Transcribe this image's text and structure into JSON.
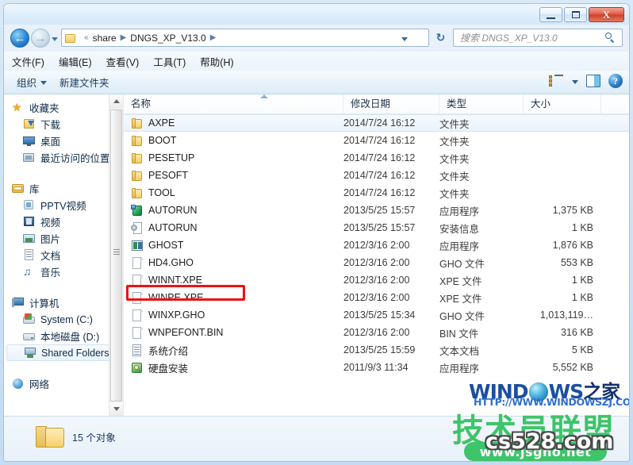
{
  "window": {
    "minimize_label": "Minimize",
    "maximize_label": "Maximize",
    "close_label": "X"
  },
  "address": {
    "back_glyph": "←",
    "forward_glyph": "→",
    "refresh_glyph": "↻",
    "root_sep": "«",
    "crumb1": "share",
    "crumb_sep": "▶",
    "crumb2": "DNGS_XP_V13.0",
    "trailing_sep": "▶"
  },
  "search": {
    "placeholder": "搜索 DNGS_XP_V13.0"
  },
  "menubar": {
    "items": [
      {
        "label": "文件(F)"
      },
      {
        "label": "编辑(E)"
      },
      {
        "label": "查看(V)"
      },
      {
        "label": "工具(T)"
      },
      {
        "label": "帮助(H)"
      }
    ]
  },
  "toolbar": {
    "organize_label": "组织",
    "new_folder_label": "新建文件夹",
    "help_glyph": "?"
  },
  "sidebar": {
    "groups": [
      {
        "header": {
          "label": "收藏夹",
          "icon": "star-icon"
        },
        "items": [
          {
            "label": "下载",
            "icon": "downloads-icon"
          },
          {
            "label": "桌面",
            "icon": "desktop-icon"
          },
          {
            "label": "最近访问的位置",
            "icon": "recent-places-icon"
          }
        ]
      },
      {
        "header": {
          "label": "库",
          "icon": "library-icon"
        },
        "items": [
          {
            "label": "PPTV视频",
            "icon": "pptv-icon"
          },
          {
            "label": "视频",
            "icon": "videos-icon"
          },
          {
            "label": "图片",
            "icon": "pictures-icon"
          },
          {
            "label": "文档",
            "icon": "documents-icon"
          },
          {
            "label": "音乐",
            "icon": "music-icon"
          }
        ]
      },
      {
        "header": {
          "label": "计算机",
          "icon": "computer-icon"
        },
        "items": [
          {
            "label": "System (C:)",
            "icon": "system-drive-icon"
          },
          {
            "label": "本地磁盘 (D:)",
            "icon": "drive-icon"
          },
          {
            "label": "Shared Folders",
            "icon": "shared-folders-icon",
            "selected": true
          }
        ]
      },
      {
        "header": {
          "label": "网络",
          "icon": "network-icon"
        },
        "items": []
      }
    ]
  },
  "filelist": {
    "columns": [
      {
        "label": "名称"
      },
      {
        "label": "修改日期"
      },
      {
        "label": "类型"
      },
      {
        "label": "大小"
      }
    ],
    "rows": [
      {
        "name": "AXPE",
        "date": "2014/7/24 16:12",
        "type": "文件夹",
        "size": "",
        "icon": "folder-icon",
        "selected": true
      },
      {
        "name": "BOOT",
        "date": "2014/7/24 16:12",
        "type": "文件夹",
        "size": "",
        "icon": "folder-icon"
      },
      {
        "name": "PESETUP",
        "date": "2014/7/24 16:12",
        "type": "文件夹",
        "size": "",
        "icon": "folder-icon"
      },
      {
        "name": "PESOFT",
        "date": "2014/7/24 16:12",
        "type": "文件夹",
        "size": "",
        "icon": "folder-icon"
      },
      {
        "name": "TOOL",
        "date": "2014/7/24 16:12",
        "type": "文件夹",
        "size": "",
        "icon": "folder-icon"
      },
      {
        "name": "AUTORUN",
        "date": "2013/5/25 15:57",
        "type": "应用程序",
        "size": "1,375 KB",
        "icon": "application-icon",
        "highlighted": true
      },
      {
        "name": "AUTORUN",
        "date": "2013/5/25 15:57",
        "type": "安装信息",
        "size": "1 KB",
        "icon": "setup-information-icon"
      },
      {
        "name": "GHOST",
        "date": "2012/3/16 2:00",
        "type": "应用程序",
        "size": "1,876 KB",
        "icon": "ghost-app-icon"
      },
      {
        "name": "HD4.GHO",
        "date": "2012/3/16 2:00",
        "type": "GHO 文件",
        "size": "553 KB",
        "icon": "generic-file-icon"
      },
      {
        "name": "WINNT.XPE",
        "date": "2012/3/16 2:00",
        "type": "XPE 文件",
        "size": "1 KB",
        "icon": "generic-file-icon"
      },
      {
        "name": "WINPE.XPE",
        "date": "2012/3/16 2:00",
        "type": "XPE 文件",
        "size": "1 KB",
        "icon": "generic-file-icon"
      },
      {
        "name": "WINXP.GHO",
        "date": "2013/5/25 15:34",
        "type": "GHO 文件",
        "size": "1,013,119…",
        "icon": "generic-file-icon"
      },
      {
        "name": "WNPEFONT.BIN",
        "date": "2012/3/16 2:00",
        "type": "BIN 文件",
        "size": "316 KB",
        "icon": "generic-file-icon"
      },
      {
        "name": "系统介绍",
        "date": "2013/5/25 15:59",
        "type": "文本文档",
        "size": "5 KB",
        "icon": "text-document-icon"
      },
      {
        "name": "硬盘安装",
        "date": "2011/9/3 11:34",
        "type": "应用程序",
        "size": "5,552 KB",
        "icon": "setup-application-icon"
      }
    ]
  },
  "statusbar": {
    "item_count": "15 个对象"
  },
  "watermark": {
    "brand_part1": "WIND",
    "brand_part2": "WS",
    "brand_cn": "之家",
    "url": "HTTP://WWW.WINDOWSZJ.COM/",
    "jsg_cn": "技术员联盟",
    "jsg_url": "www.jsgho.net",
    "cs_url": "cs528.com"
  },
  "colors": {
    "accent": "#2b7ec4",
    "highlight_red": "#ee1111",
    "folder_yellow": "#f5cd67",
    "watermark_blue": "#1a4fa0",
    "watermark_green": "#3ec46a"
  }
}
